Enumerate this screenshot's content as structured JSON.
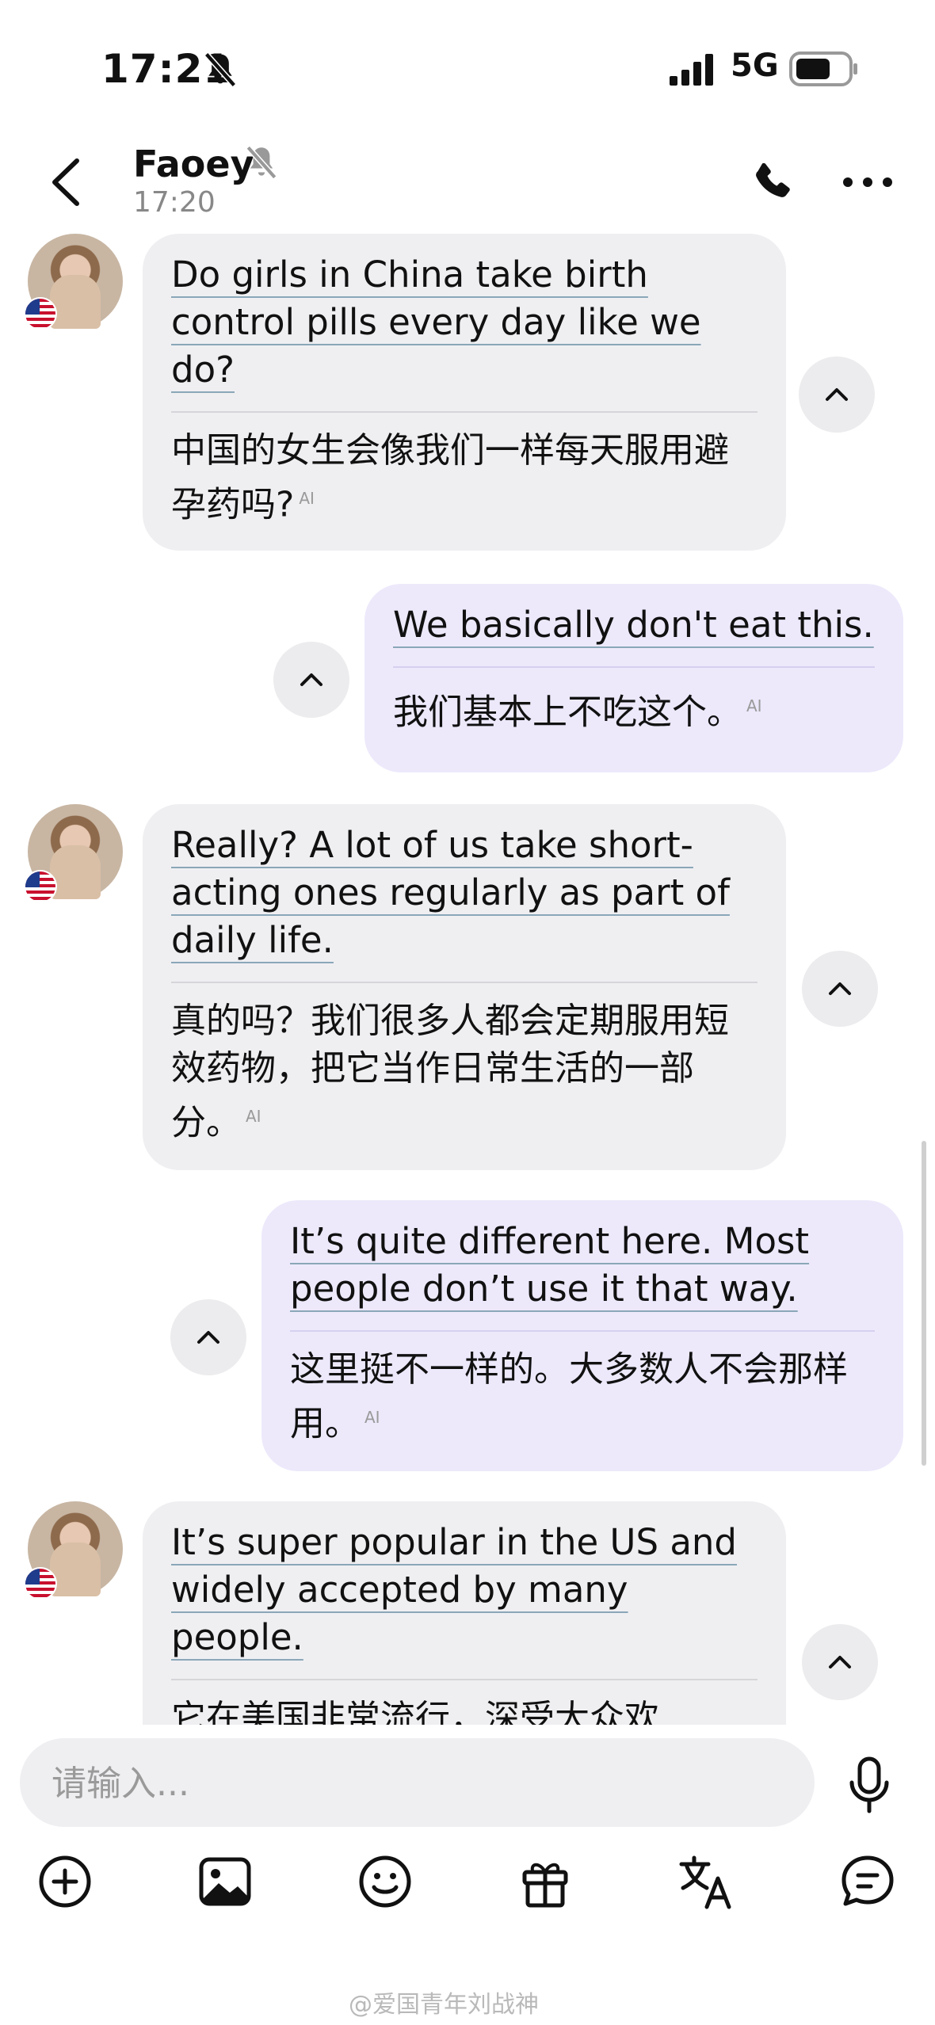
{
  "status": {
    "time": "17:21",
    "network": "5G"
  },
  "header": {
    "name": "Faoey",
    "time": "17:20"
  },
  "messages": [
    {
      "en": "Do girls in China take birth control pills every day like we do?",
      "zh": "中国的女生会像我们一样每天服用避孕药吗?",
      "ai": "AI"
    },
    {
      "en": "We basically don't eat this.",
      "zh": "我们基本上不吃这个。",
      "ai": "AI"
    },
    {
      "en": "Really? A lot of us take short-acting ones regularly as part of daily life.",
      "zh": "真的吗？我们很多人都会定期服用短效药物，把它当作日常生活的一部分。",
      "ai": "AI"
    },
    {
      "en": "It’s quite different here. Most people don’t use it that way.",
      "zh": "这里挺不一样的。大多数人不会那样用。",
      "ai": "AI"
    },
    {
      "en": "It’s super popular in the US and widely accepted by many people.",
      "zh": "它在美国非常流行，深受大众欢",
      "ai": ""
    }
  ],
  "input": {
    "placeholder": "请输入..."
  },
  "icons": {
    "add": "plus-circle-icon",
    "image": "image-icon",
    "emoji": "smile-icon",
    "gift": "gift-icon",
    "translate": "translate-icon",
    "chat": "chat-bubble-icon"
  },
  "watermark": "@爱国青年刘战神"
}
